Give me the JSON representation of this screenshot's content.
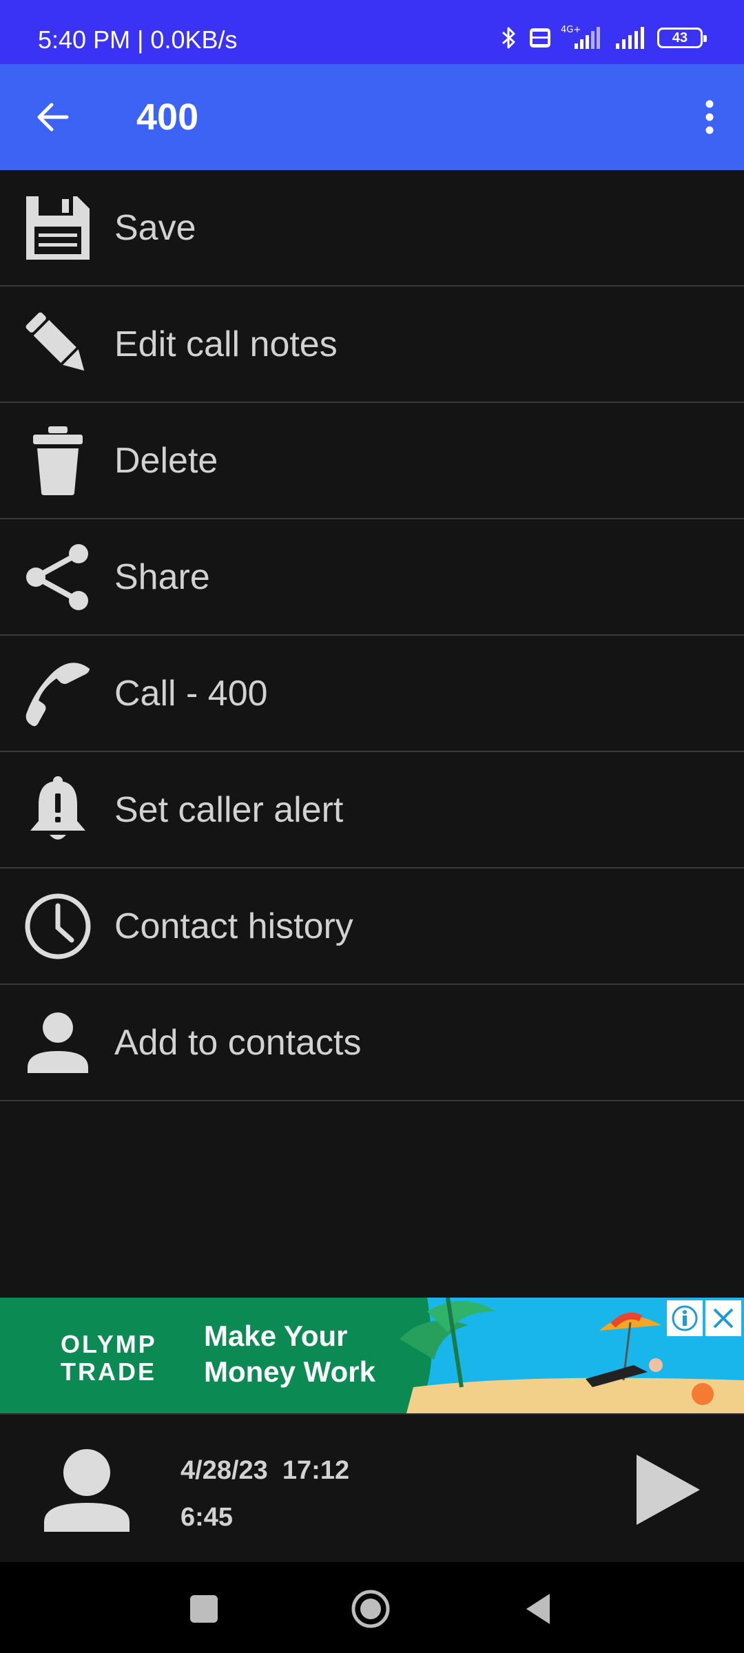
{
  "status_bar": {
    "time": "5:40 PM | 0.0KB/s",
    "icons": [
      "bluetooth-icon",
      "volte-icon",
      "signal-4g-icon",
      "signal-icon"
    ],
    "battery": "43"
  },
  "app_bar": {
    "title": "400",
    "back_icon": "arrow-left-icon",
    "overflow_icon": "more-vert-icon"
  },
  "menu": {
    "items": [
      {
        "label": "Save",
        "icon": "floppy-disk-icon"
      },
      {
        "label": "Edit call notes",
        "icon": "pencil-icon"
      },
      {
        "label": "Delete",
        "icon": "trash-icon"
      },
      {
        "label": "Share",
        "icon": "share-icon"
      },
      {
        "label": "Call - 400",
        "icon": "phone-icon"
      },
      {
        "label": "Set caller alert",
        "icon": "bell-alert-icon"
      },
      {
        "label": "Contact history",
        "icon": "clock-icon"
      },
      {
        "label": "Add to contacts",
        "icon": "person-icon"
      }
    ]
  },
  "ad": {
    "brand_line1": "OLYMP",
    "brand_line2": "TRADE",
    "text_line1": "Make Your",
    "text_line2": "Money Work"
  },
  "player": {
    "date": "4/28/23  17:12",
    "duration": "6:45"
  },
  "nav_bar": {
    "buttons": [
      "recents-square-icon",
      "home-circle-icon",
      "back-triangle-icon"
    ]
  },
  "colors": {
    "status_bar": "#3a33f5",
    "app_bar": "#3d63f5",
    "background": "#141414",
    "menu_text": "#d2d2d2",
    "ad_green": "#0b8a54"
  }
}
